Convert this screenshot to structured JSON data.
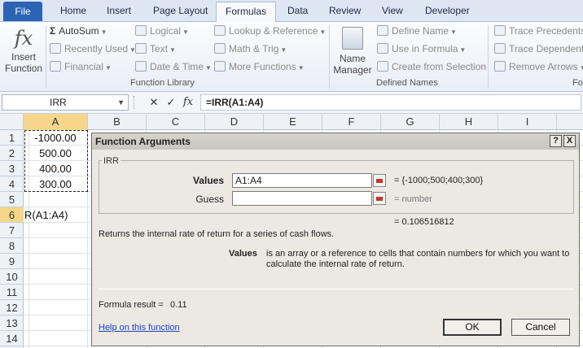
{
  "ribbon_tabs": {
    "file": "File",
    "home": "Home",
    "insert": "Insert",
    "page_layout": "Page Layout",
    "formulas": "Formulas",
    "data": "Data",
    "review": "Review",
    "view": "View",
    "developer": "Developer"
  },
  "ribbon": {
    "insert_function_line1": "Insert",
    "insert_function_line2": "Function",
    "autosum": "AutoSum",
    "recently_used": "Recently Used",
    "financial": "Financial",
    "logical": "Logical",
    "text": "Text",
    "date_time": "Date & Time",
    "lookup_reference": "Lookup & Reference",
    "math_trig": "Math & Trig",
    "more_functions": "More Functions",
    "function_library": "Function Library",
    "name_manager_line1": "Name",
    "name_manager_line2": "Manager",
    "define_name": "Define Name",
    "use_in_formula": "Use in Formula",
    "create_from_selection": "Create from Selection",
    "defined_names": "Defined Names",
    "trace_precedents": "Trace Precedents",
    "trace_dependents": "Trace Dependents",
    "remove_arrows": "Remove Arrows",
    "formula_auditing_partial": "Fo"
  },
  "formula_bar": {
    "name_box": "IRR",
    "cancel_glyph": "✕",
    "enter_glyph": "✓",
    "fx_glyph": "fx",
    "formula": "=IRR(A1:A4)"
  },
  "grid": {
    "columns": [
      "A",
      "B",
      "C",
      "D",
      "E",
      "F",
      "G",
      "H",
      "I"
    ],
    "rows": [
      "1",
      "2",
      "3",
      "4",
      "5",
      "6",
      "7",
      "8",
      "9",
      "10",
      "11",
      "12",
      "13",
      "14"
    ],
    "cells": {
      "A1": "-1000.00",
      "A2": "500.00",
      "A3": "400.00",
      "A4": "300.00",
      "A6": "R(A1:A4)"
    }
  },
  "dialog": {
    "title": "Function Arguments",
    "help_button": "?",
    "close_button": "X",
    "function_name": "IRR",
    "values_label": "Values",
    "values_input": "A1:A4",
    "values_result": "= {-1000;500;400;300}",
    "guess_label": "Guess",
    "guess_input": "",
    "guess_result": "= number",
    "overall_result": "= 0.106516812",
    "description": "Returns the internal rate of return for a series of cash flows.",
    "arg_name": "Values",
    "arg_description_line1": "is an array or a reference to cells that contain numbers for which you want to",
    "arg_description_line2": "calculate the internal rate of return.",
    "formula_result_label": "Formula result =",
    "formula_result_value": "0.11",
    "help_link": "Help on this function",
    "ok_button": "OK",
    "cancel_button": "Cancel"
  }
}
